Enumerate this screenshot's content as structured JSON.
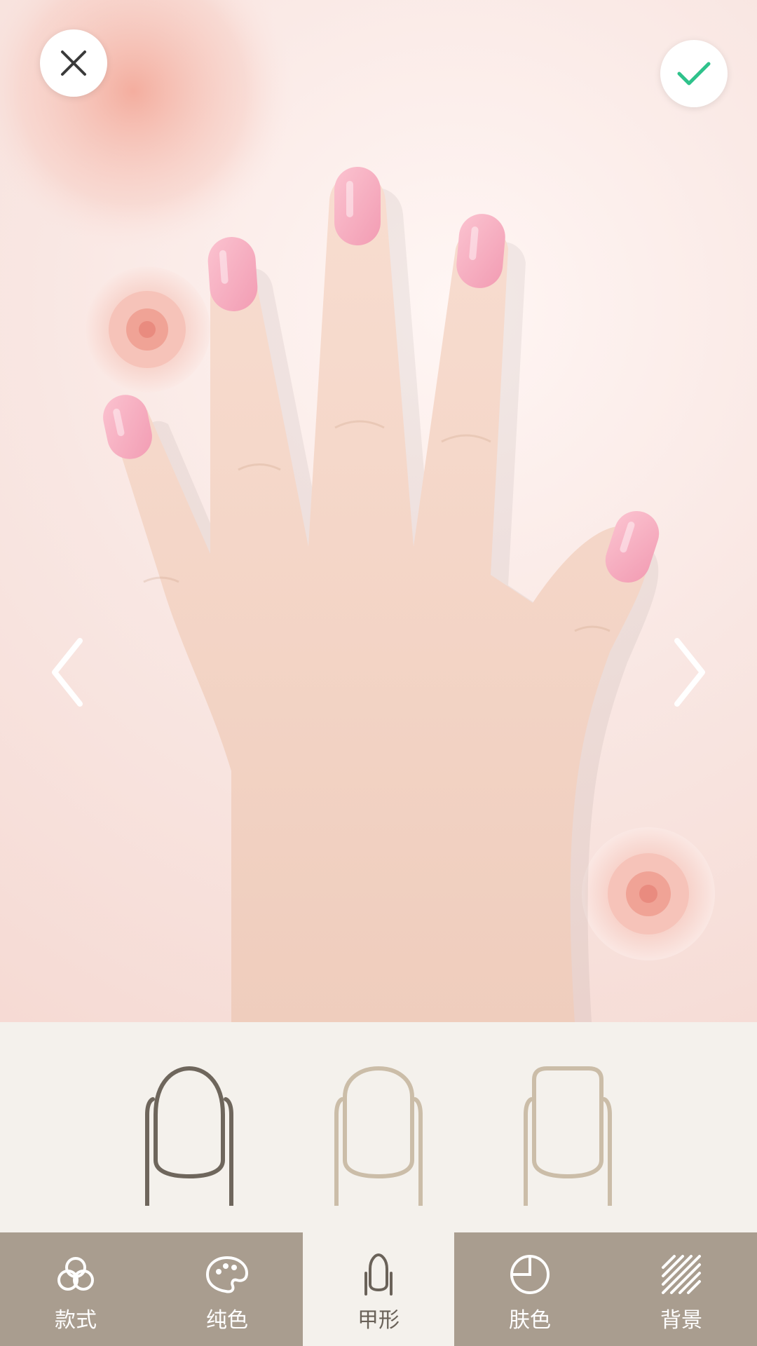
{
  "colors": {
    "accent_check": "#2ec28b",
    "tab_bar_bg": "#a99d8f",
    "tab_active_bg": "#f4f1ec",
    "shape_selected": "#6e665c",
    "shape_unselected": "#cbbda8",
    "nail_pink": "#f4a9bd"
  },
  "header": {
    "close_icon": "close-icon",
    "confirm_icon": "check-icon"
  },
  "navigation": {
    "prev_icon": "chevron-left-icon",
    "next_icon": "chevron-right-icon"
  },
  "nail_shapes": {
    "options": [
      "almond",
      "oval",
      "squoval"
    ],
    "selected_index": 0
  },
  "tabs": [
    {
      "label": "款式",
      "icon": "styles-circles-icon",
      "active": false
    },
    {
      "label": "纯色",
      "icon": "palette-icon",
      "active": false
    },
    {
      "label": "甲形",
      "icon": "nail-shape-icon",
      "active": true
    },
    {
      "label": "肤色",
      "icon": "skin-tone-icon",
      "active": false
    },
    {
      "label": "背景",
      "icon": "background-stripes-icon",
      "active": false
    }
  ]
}
